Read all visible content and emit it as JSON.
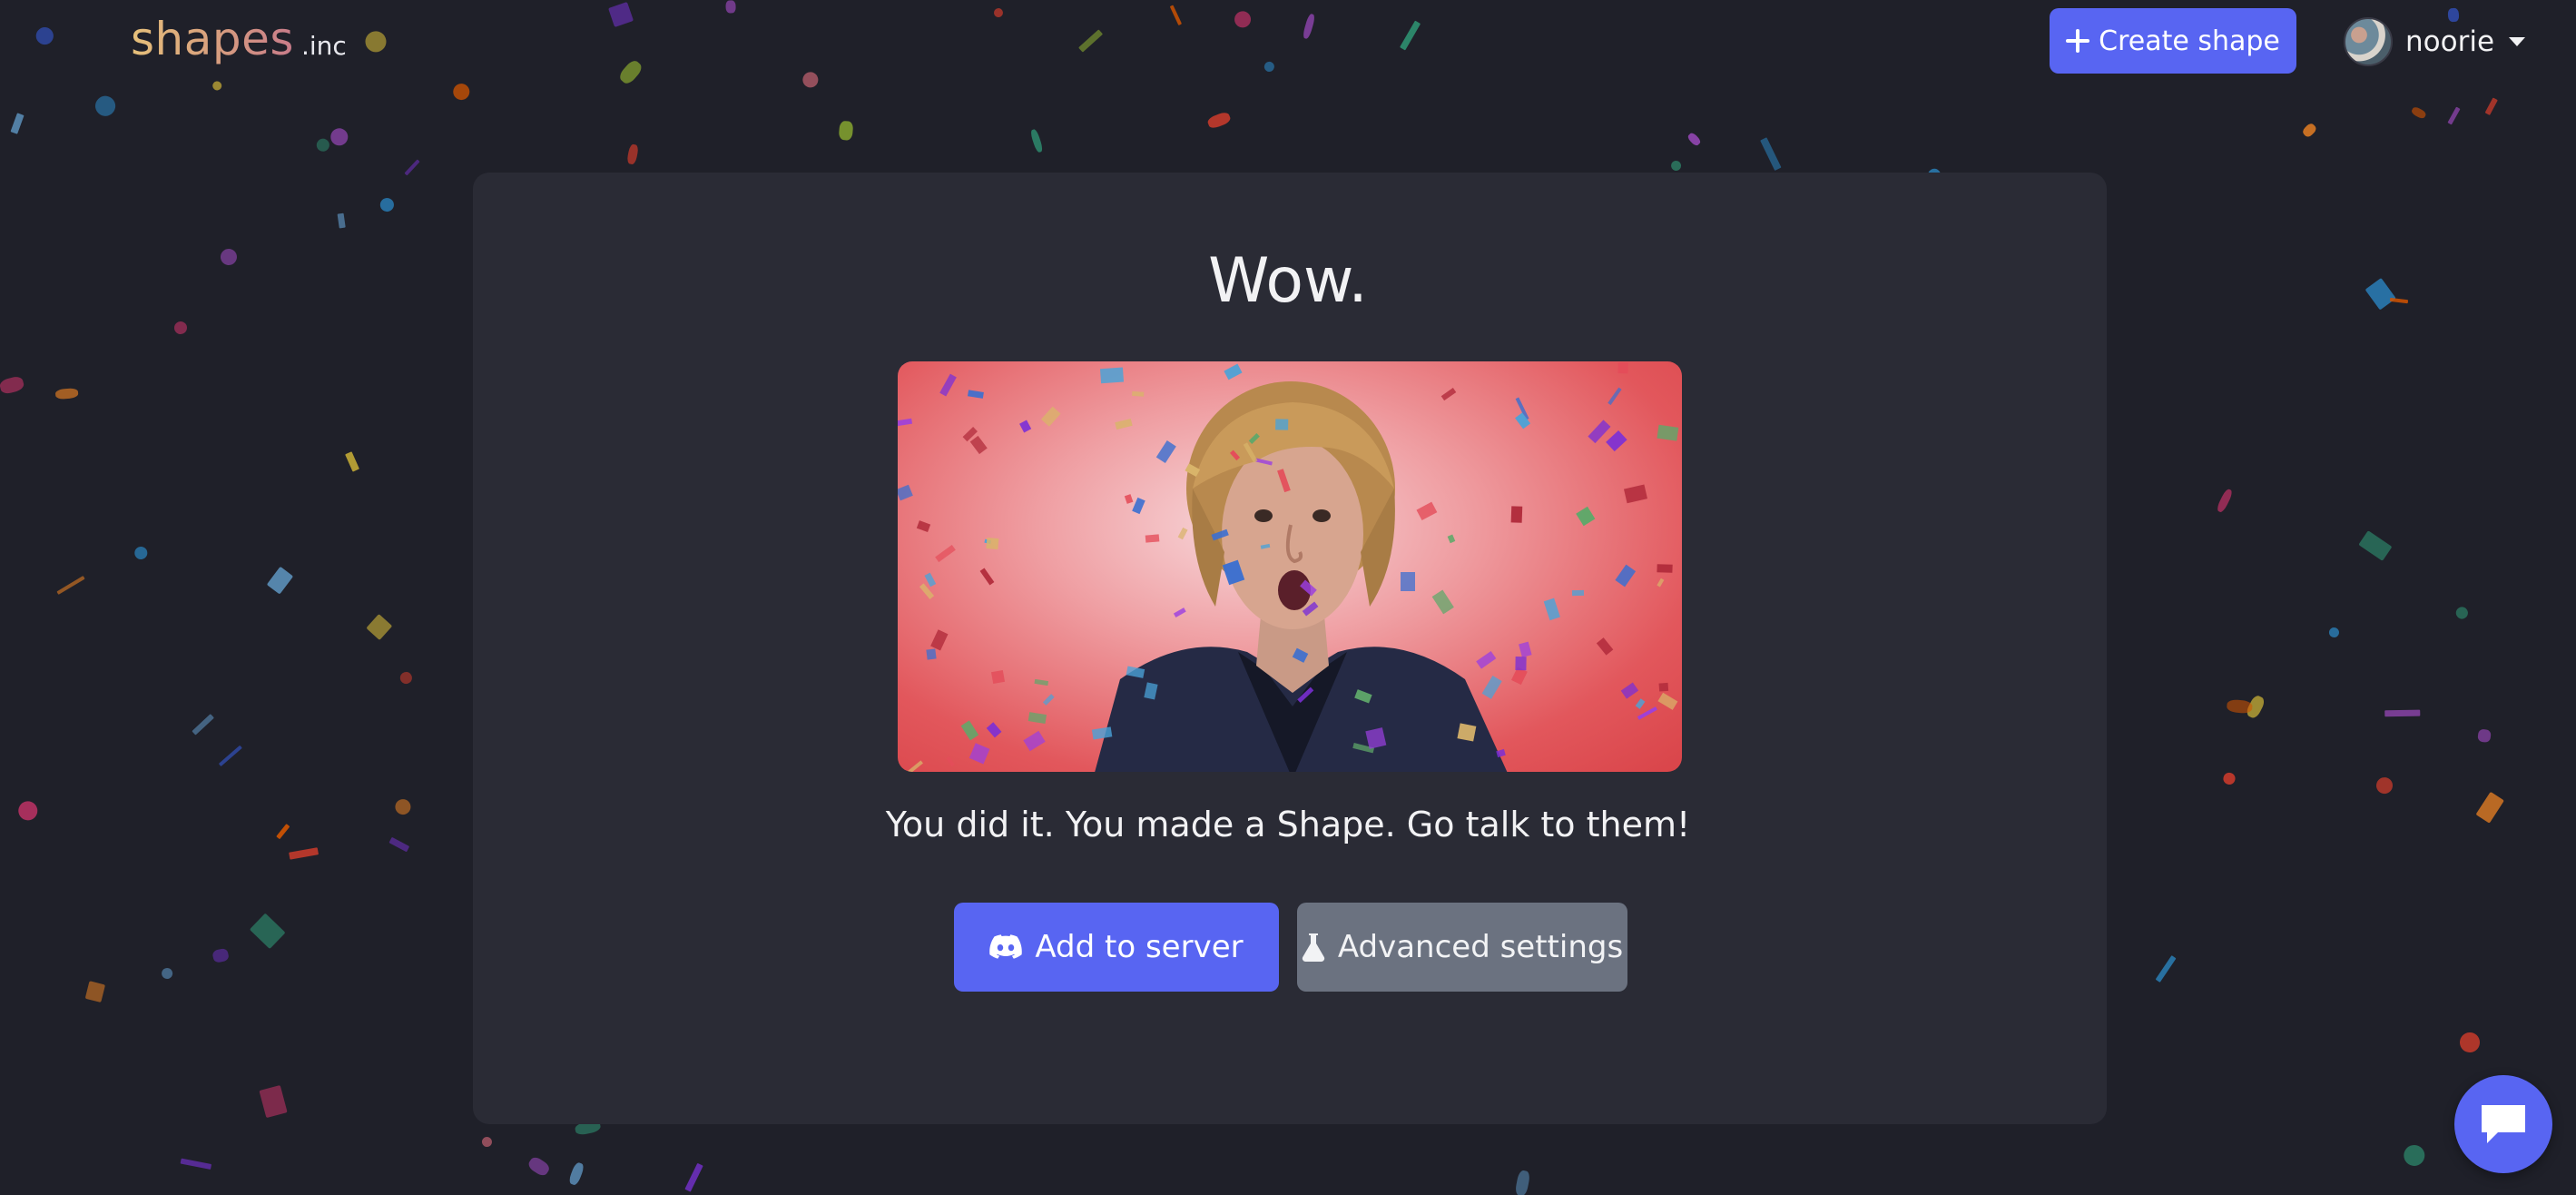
{
  "header": {
    "logo_word": "shapes",
    "logo_suffix": ".inc",
    "create_label": "Create shape",
    "username": "noorie"
  },
  "main": {
    "title": "Wow.",
    "message": "You did it. You made a Shape. Go talk to them!",
    "add_server_label": "Add to server",
    "advanced_label": "Advanced settings"
  },
  "colors": {
    "background": "#1f2029",
    "card": "#2a2b35",
    "accent": "#5865f2",
    "secondary_button": "#6b7280"
  },
  "icons": {
    "create": "plus-icon",
    "user_menu": "chevron-down-icon",
    "add_server": "discord-icon",
    "advanced": "flask-icon",
    "chat": "chat-icon"
  }
}
